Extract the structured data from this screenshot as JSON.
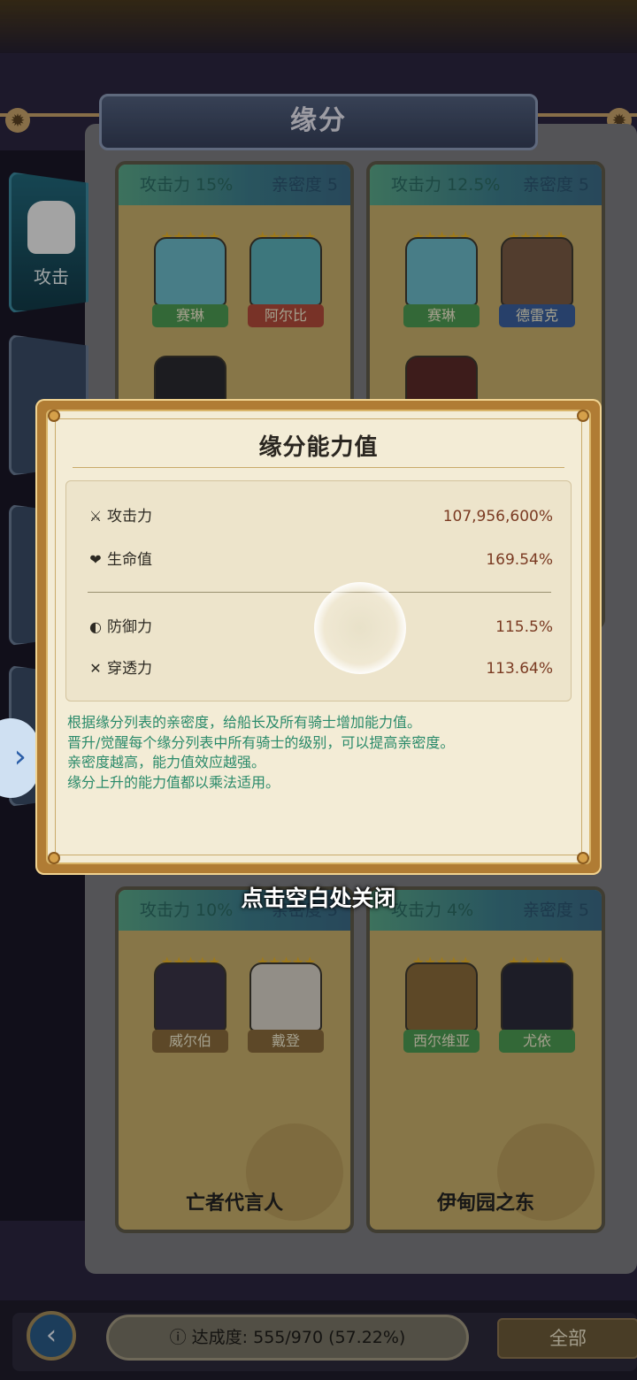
{
  "header": {
    "title": "缘分"
  },
  "sidebar": {
    "active_tab_label": "攻击",
    "expand_arrow": "›"
  },
  "cards": [
    {
      "atk": "攻击力 15%",
      "affinity": "亲密度 5",
      "characters": [
        {
          "name": "赛琳",
          "stars": "★★★★★",
          "plate": "green"
        },
        {
          "name": "阿尔比",
          "stars": "★★★★★",
          "plate": "red"
        }
      ],
      "footer": ""
    },
    {
      "atk": "攻击力 12.5%",
      "affinity": "亲密度 5",
      "characters": [
        {
          "name": "赛琳",
          "stars": "★★★★★",
          "plate": "green"
        },
        {
          "name": "德雷克",
          "stars": "★★★★★",
          "plate": "blue"
        }
      ],
      "footer": ""
    },
    {
      "atk": "攻击力 10%",
      "affinity": "亲密度 5",
      "characters": [
        {
          "name": "威尔伯",
          "stars": "★★★★★",
          "plate": "tan"
        },
        {
          "name": "戴登",
          "stars": "★★★★★",
          "plate": "tan"
        }
      ],
      "footer": "亡者代言人"
    },
    {
      "atk": "攻击力 4%",
      "affinity": "亲密度 5",
      "characters": [
        {
          "name": "西尔维亚",
          "stars": "★★★★★",
          "plate": "green"
        },
        {
          "name": "尤依",
          "stars": "★★★★★",
          "plate": "green"
        }
      ],
      "footer": "伊甸园之东"
    }
  ],
  "bottom_bar": {
    "back_icon": "‹",
    "progress": "ⓘ 达成度: 555/970 (57.22%)",
    "filter_label": "全部"
  },
  "modal": {
    "title": "缘分能力值",
    "stats": [
      {
        "icon": "sword-icon",
        "glyph": "⚔",
        "label": "攻击力",
        "value": "107,956,600%"
      },
      {
        "icon": "heart-icon",
        "glyph": "❤",
        "label": "生命值",
        "value": "169.54%"
      },
      {
        "icon": "shield-icon",
        "glyph": "◐",
        "label": "防御力",
        "value": "115.5%"
      },
      {
        "icon": "pierce-icon",
        "glyph": "✕",
        "label": "穿透力",
        "value": "113.64%"
      }
    ],
    "description": [
      "根据缘分列表的亲密度，给船长及所有骑士增加能力值。",
      " 晋升/觉醒每个缘分列表中所有骑士的级别，可以提高亲密度。",
      "亲密度越高，能力值效应越强。",
      "缘分上升的能力值都以乘法适用。"
    ],
    "close_hint": "点击空白处关闭"
  },
  "colors": {
    "modal_frame": "#b07c34",
    "modal_bg": "#f3ecd6",
    "value_text": "#7a3a22",
    "desc_text": "#2a8a6a"
  }
}
